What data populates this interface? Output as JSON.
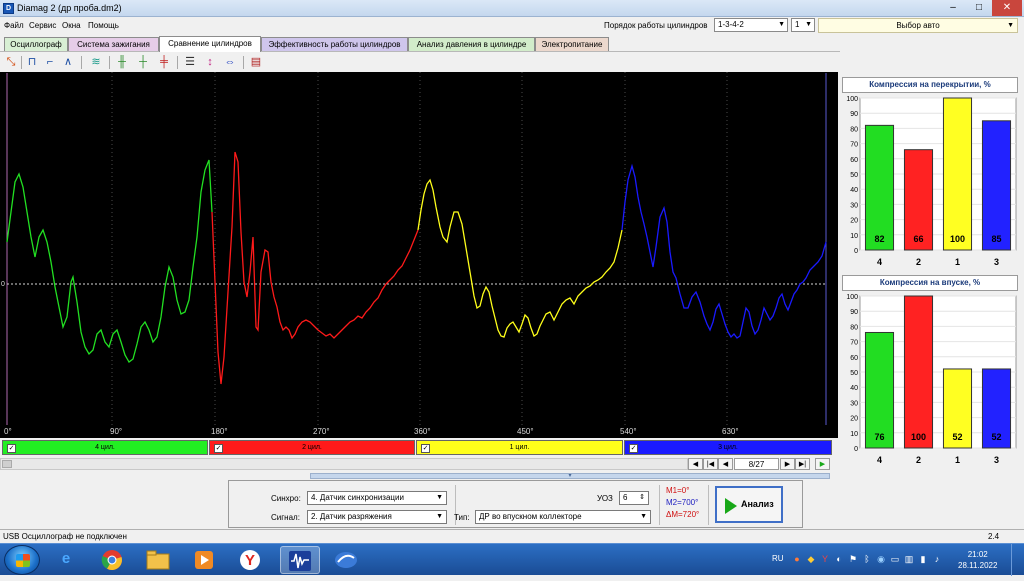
{
  "window": {
    "title": "Diamag 2 (др проба.dm2)",
    "app_icon": "D",
    "minimize": "–",
    "maximize": "□",
    "close": "✕"
  },
  "menu": [
    "Файл",
    "Сервис",
    "Окна",
    "Помощь"
  ],
  "cylinder_order": {
    "label": "Порядок работы цилиндров",
    "value": "1-3-4-2",
    "index_value": "1"
  },
  "auto_select": {
    "value": "Выбор авто"
  },
  "tabs": [
    {
      "label": "Осциллограф",
      "color": "#d8efd4"
    },
    {
      "label": "Система зажигания",
      "color": "#e6cde8"
    },
    {
      "label": "Сравнение цилиндров",
      "color": "#ffffff"
    },
    {
      "label": "Эффективность работы цилиндров",
      "color": "#cfc6ec"
    },
    {
      "label": "Анализ давления в цилиндре",
      "color": "#d2ecca"
    },
    {
      "label": "Электропитание",
      "color": "#ecd8cd"
    }
  ],
  "toolbar_icons": [
    "cursor-select-icon",
    "pulse-icon",
    "pulse-up-icon",
    "pulse-peak-icon",
    "filter-icon",
    "multi-cylinder-icon",
    "marker-icon",
    "cylinder-split-icon",
    "grid-lines-icon",
    "vertical-scale-icon",
    "horizontal-scale-icon",
    "print-icon"
  ],
  "oscillogram": {
    "zero_label": "0",
    "x_ticks": [
      "0°",
      "90°",
      "180°",
      "270°",
      "360°",
      "450°",
      "540°",
      "630°"
    ],
    "channel_colors": [
      "#22e022",
      "#ff1a1a",
      "#ffff1a",
      "#1a1aff"
    ]
  },
  "channels": [
    {
      "label": "4 цил.",
      "color": "#22ee22",
      "checked": true
    },
    {
      "label": "2 цил.",
      "color": "#ff1a1a",
      "checked": true
    },
    {
      "label": "1 цил.",
      "color": "#ffff1a",
      "checked": true
    },
    {
      "label": "3 цил.",
      "color": "#1a1aff",
      "checked": true
    }
  ],
  "navigation": {
    "page": "8/27",
    "first": "|◀",
    "prev": "◀",
    "next": "▶",
    "last": "▶|",
    "play": "▶"
  },
  "controls": {
    "sync_label": "Синхро:",
    "sync_value": "4. Датчик синхронизации",
    "signal_label": "Сигнал:",
    "signal_value": "2. Датчик разряжения",
    "uoz_label": "УОЗ",
    "uoz_value": "6",
    "type_label": "Тип:",
    "type_value": "ДР во впускном коллекторе",
    "m1": "M1=0°",
    "m2": "M2=700°",
    "dm": "ΔM=720°",
    "analyze_label": "Анализ"
  },
  "compression_overlap": {
    "title": "Компрессия на перекрытии, %",
    "y_ticks": [
      "100",
      "90",
      "80",
      "70",
      "60",
      "50",
      "40",
      "30",
      "20",
      "10",
      "0"
    ]
  },
  "compression_intake": {
    "title": "Компрессия на впуске, %",
    "y_ticks": [
      "100",
      "90",
      "80",
      "70",
      "60",
      "50",
      "40",
      "30",
      "20",
      "10",
      "0"
    ]
  },
  "chart_data": [
    {
      "type": "bar",
      "title": "Компрессия на перекрытии, %",
      "categories": [
        "4",
        "2",
        "1",
        "3"
      ],
      "values": [
        82,
        66,
        100,
        85
      ],
      "colors": [
        "#22dd22",
        "#ff2222",
        "#ffff22",
        "#2222ff"
      ],
      "ylim": [
        0,
        100
      ]
    },
    {
      "type": "bar",
      "title": "Компрессия на впуске, %",
      "categories": [
        "4",
        "2",
        "1",
        "3"
      ],
      "values": [
        76,
        100,
        52,
        52
      ],
      "colors": [
        "#22dd22",
        "#ff2222",
        "#ffff22",
        "#2222ff"
      ],
      "ylim": [
        0,
        100
      ]
    }
  ],
  "status": {
    "usb": "USB Осциллограф не подключен",
    "value": "2.4"
  },
  "taskbar": {
    "apps": [
      "ie-icon",
      "chrome-icon",
      "explorer-icon",
      "media-player-icon",
      "yandex-icon",
      "diamag-icon",
      "browser-icon"
    ],
    "lang": "RU",
    "time": "21:02",
    "date": "28.11.2022"
  }
}
